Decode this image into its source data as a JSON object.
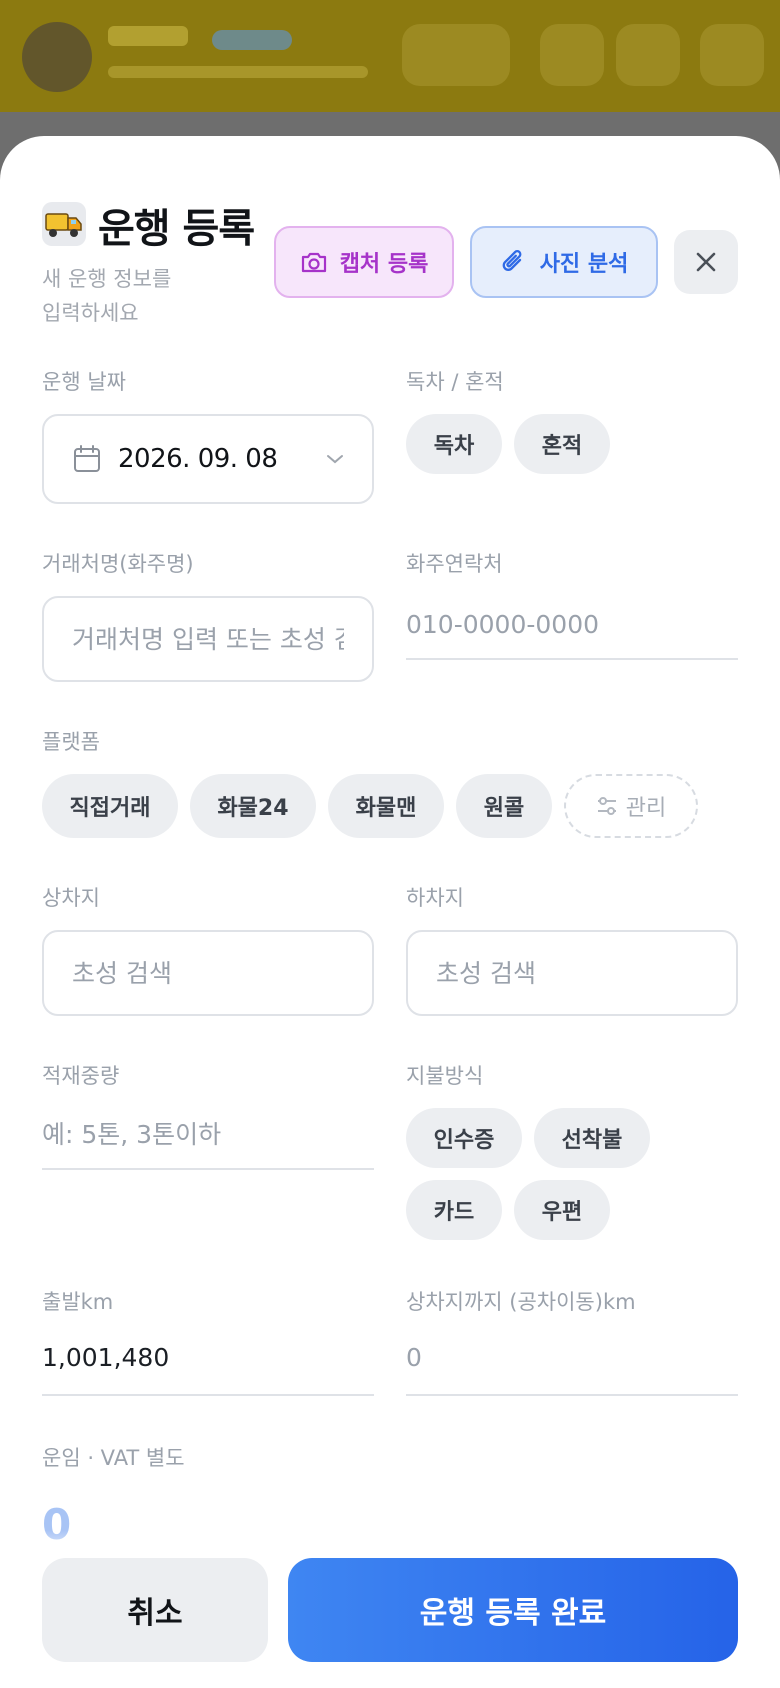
{
  "modal": {
    "title": "운행 등록",
    "subtitle": "새 운행 정보를\n입력하세요",
    "capture_button": "캡처 등록",
    "photo_button": "사진 분석"
  },
  "date": {
    "label": "운행 날짜",
    "value": "2026. 09. 08"
  },
  "load_type": {
    "label": "독차 / 혼적",
    "options": [
      "독차",
      "혼적"
    ]
  },
  "client": {
    "label": "거래처명(화주명)",
    "placeholder": "거래처명 입력 또는 초성 검색"
  },
  "contact": {
    "label": "화주연락처",
    "placeholder": "010-0000-0000"
  },
  "platform": {
    "label": "플랫폼",
    "options": [
      "직접거래",
      "화물24",
      "화물맨",
      "원콜"
    ],
    "manage": "관리"
  },
  "pickup": {
    "label": "상차지",
    "placeholder": "초성 검색"
  },
  "dropoff": {
    "label": "하차지",
    "placeholder": "초성 검색"
  },
  "weight": {
    "label": "적재중량",
    "placeholder": "예: 5톤, 3톤이하"
  },
  "payment": {
    "label": "지불방식",
    "options": [
      "인수증",
      "선착불",
      "카드",
      "우편"
    ]
  },
  "start_km": {
    "label": "출발km",
    "value": "1,001,480"
  },
  "empty_km": {
    "label": "상차지까지 (공차이동)km",
    "placeholder": "0"
  },
  "fare": {
    "label": "운임 · VAT 별도",
    "value": "0"
  },
  "footer": {
    "cancel": "취소",
    "submit": "운행 등록 완료"
  },
  "colors": {
    "primary": "#2f6ae6",
    "capture_accent": "#a633c9",
    "chip_bg": "#eceef1"
  }
}
